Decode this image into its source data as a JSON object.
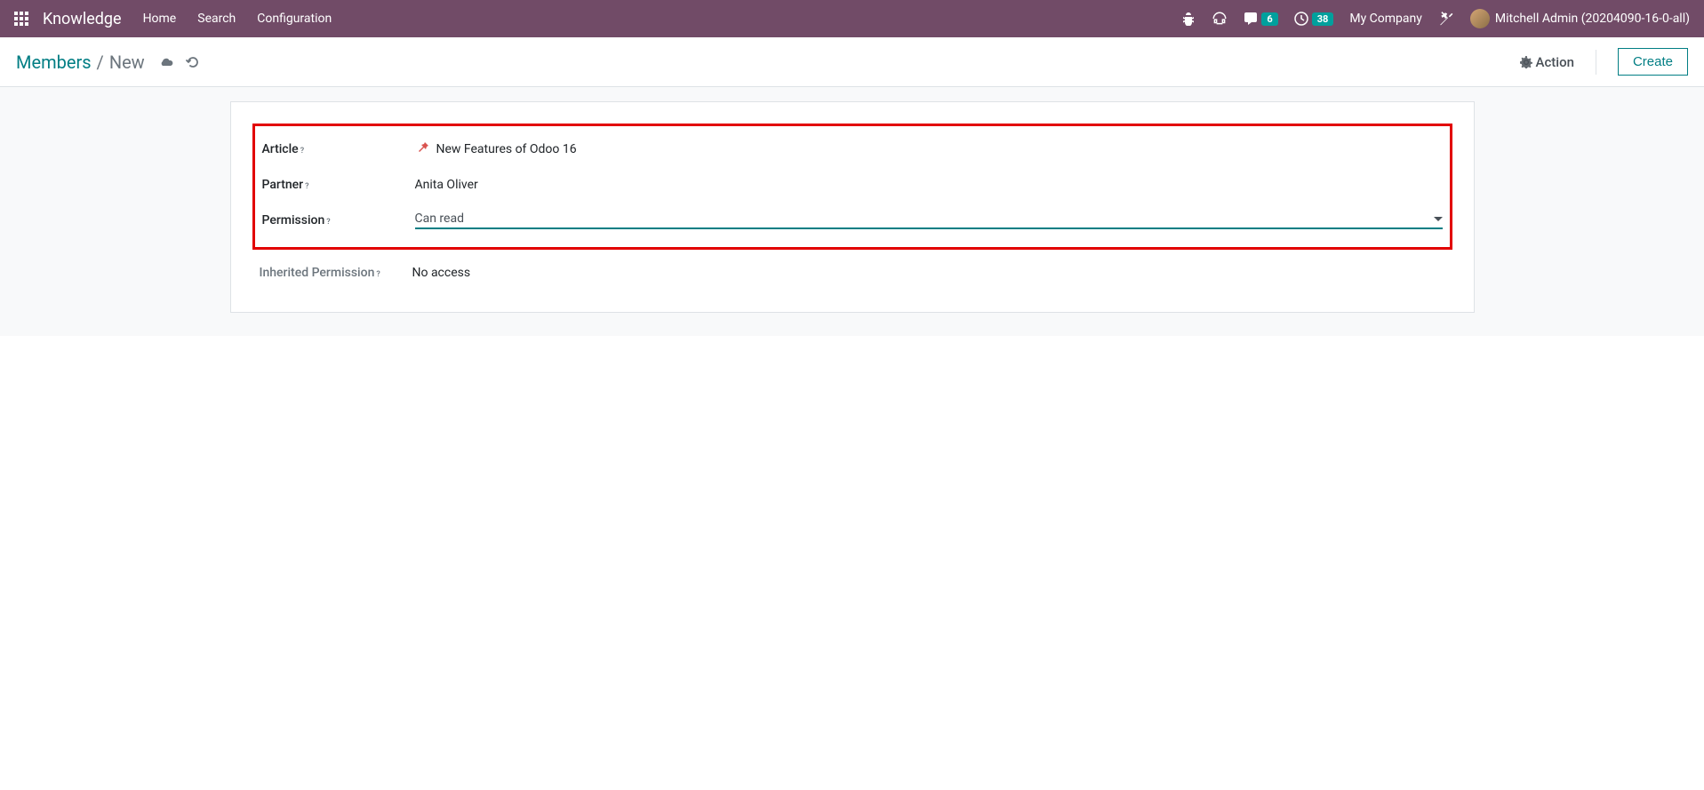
{
  "topbar": {
    "app_name": "Knowledge",
    "nav": {
      "home": "Home",
      "search": "Search",
      "config": "Configuration"
    },
    "messages_count": "6",
    "activities_count": "38",
    "company": "My Company",
    "user": "Mitchell Admin (20204090-16-0-all)"
  },
  "control_panel": {
    "breadcrumb_root": "Members",
    "breadcrumb_current": "New",
    "action_label": "Action",
    "create_label": "Create"
  },
  "form": {
    "article_label": "Article",
    "article_value": "New Features of Odoo 16",
    "partner_label": "Partner",
    "partner_value": "Anita Oliver",
    "permission_label": "Permission",
    "permission_value": "Can read",
    "inherited_label": "Inherited Permission",
    "inherited_value": "No access"
  }
}
